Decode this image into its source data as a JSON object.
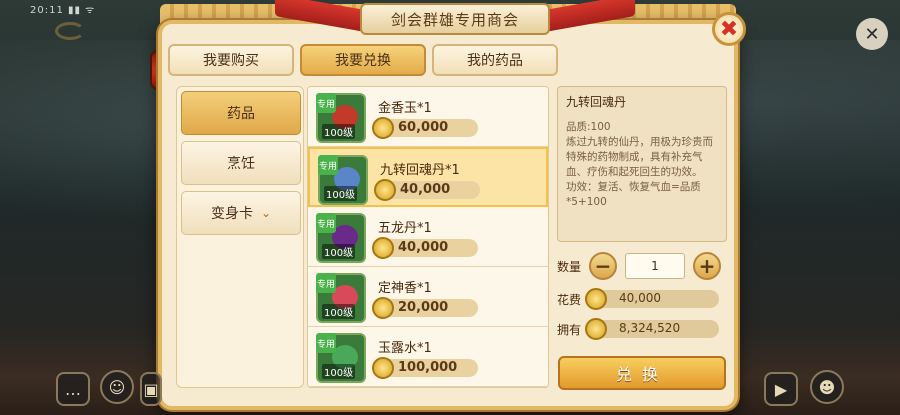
{
  "status_bar": {
    "time": "20:11 ▮▮ ᯤ"
  },
  "window": {
    "title": "剑会群雄专用商会"
  },
  "tabs": [
    {
      "label": "我要购买",
      "active": false
    },
    {
      "label": "我要兑换",
      "active": true
    },
    {
      "label": "我的药品",
      "active": false
    }
  ],
  "side_menu": [
    {
      "label": "药品",
      "active": true
    },
    {
      "label": "烹饪",
      "active": false
    },
    {
      "label": "变身卡",
      "active": false,
      "has_dropdown": true
    }
  ],
  "items": [
    {
      "name": "金香玉*1",
      "level": "100级",
      "tag": "专用",
      "price": "60,000",
      "selected": false,
      "art_color": "#c23a2a"
    },
    {
      "name": "九转回魂丹*1",
      "level": "100级",
      "tag": "专用",
      "price": "40,000",
      "selected": true,
      "art_color": "#5a86c8"
    },
    {
      "name": "五龙丹*1",
      "level": "100级",
      "tag": "专用",
      "price": "40,000",
      "selected": false,
      "art_color": "#6a2a8a"
    },
    {
      "name": "定神香*1",
      "level": "100级",
      "tag": "专用",
      "price": "20,000",
      "selected": false,
      "art_color": "#d84a5a"
    },
    {
      "name": "玉露水*1",
      "level": "100级",
      "tag": "专用",
      "price": "100,000",
      "selected": false,
      "art_color": "#4aa85a"
    }
  ],
  "detail": {
    "title": "九转回魂丹",
    "quality": "品质:100",
    "description": "炼过九转的仙丹，用极为珍贵而特殊的药物制成，具有补充气血、疗伤和起死回生的功效。",
    "effect": "功效：复活、恢复气血=品质*5+100"
  },
  "purchase": {
    "qty_label": "数量",
    "qty_value": "1",
    "cost_label": "花费",
    "cost_value": "40,000",
    "owned_label": "拥有",
    "owned_value": "8,324,520",
    "exchange_label": "兑换"
  },
  "colors": {
    "panel_bg": "#f6ead0",
    "accent_gold": "#e4ac4a",
    "selected_row": "#fbe4a6",
    "close_red": "#d92f26"
  },
  "icons": {
    "close": "close-icon",
    "minus": "minus-icon",
    "plus": "plus-icon",
    "coin": "coin-icon",
    "dropdown": "chevron-down-icon"
  }
}
